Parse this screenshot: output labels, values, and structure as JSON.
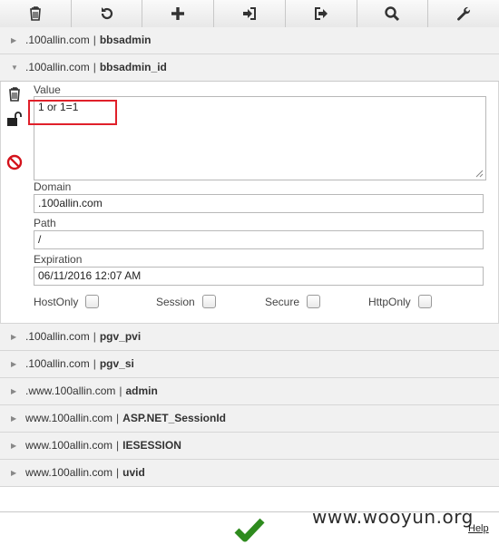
{
  "toolbar": {
    "buttons": [
      {
        "name": "delete-all",
        "icon": "trash-icon"
      },
      {
        "name": "refresh",
        "icon": "refresh-icon"
      },
      {
        "name": "add",
        "icon": "plus-icon"
      },
      {
        "name": "import",
        "icon": "import-icon"
      },
      {
        "name": "export",
        "icon": "export-icon"
      },
      {
        "name": "search",
        "icon": "search-icon"
      },
      {
        "name": "options",
        "icon": "wrench-icon"
      }
    ]
  },
  "cookies": [
    {
      "domain": ".100allin.com",
      "name": "bbsadmin",
      "open": false
    },
    {
      "domain": ".100allin.com",
      "name": "bbsadmin_id",
      "open": true
    },
    {
      "domain": ".100allin.com",
      "name": "pgv_pvi",
      "open": false
    },
    {
      "domain": ".100allin.com",
      "name": "pgv_si",
      "open": false
    },
    {
      "domain": ".www.100allin.com",
      "name": "admin",
      "open": false
    },
    {
      "domain": "www.100allin.com",
      "name": "ASP.NET_SessionId",
      "open": false
    },
    {
      "domain": "www.100allin.com",
      "name": "IESESSION",
      "open": false
    },
    {
      "domain": "www.100allin.com",
      "name": "uvid",
      "open": false
    }
  ],
  "separator": "|",
  "editor": {
    "value_label": "Value",
    "value": "1 or 1=1",
    "domain_label": "Domain",
    "domain": ".100allin.com",
    "path_label": "Path",
    "path": "/",
    "expiration_label": "Expiration",
    "expiration": "06/11/2016 12:07 AM",
    "flags": [
      {
        "label": "HostOnly",
        "checked": false
      },
      {
        "label": "Session",
        "checked": false
      },
      {
        "label": "Secure",
        "checked": false
      },
      {
        "label": "HttpOnly",
        "checked": false
      }
    ],
    "icons": [
      "trash-icon",
      "unlock-icon",
      "block-icon"
    ]
  },
  "footer": {
    "help": "Help",
    "ok_icon": "checkmark-icon",
    "ok_color": "#2e8b1e"
  },
  "watermark": "www.wooyun.org",
  "colors": {
    "highlight": "#e0202a",
    "block": "#d4121b"
  }
}
